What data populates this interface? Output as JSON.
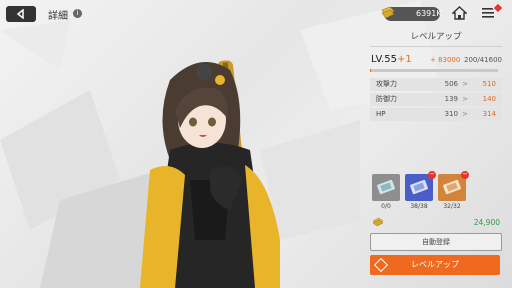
{
  "header": {
    "title": "詳細",
    "info_glyph": "i",
    "currency_value": "6391K"
  },
  "panel": {
    "title": "レベルアップ",
    "level_label": "LV.55",
    "level_increment": "+1",
    "xp_gain": "+ 83000",
    "xp_current": "200/41600",
    "xp_progress": 0.005,
    "stats": [
      {
        "name": "攻撃力",
        "current": "506",
        "arrow": ">",
        "next": "510"
      },
      {
        "name": "防御力",
        "current": "139",
        "arrow": ">",
        "next": "140"
      },
      {
        "name": "HP",
        "current": "310",
        "arrow": ">",
        "next": "314"
      }
    ],
    "items": [
      {
        "count": "0/0",
        "color": "#8e8e8e"
      },
      {
        "count": "38/38",
        "color": "#4b5ec8"
      },
      {
        "count": "32/32",
        "color": "#d2843a"
      }
    ],
    "gold_cost": "24,900",
    "auto_button": "自動登録",
    "levelup_button": "レベルアップ"
  },
  "colors": {
    "accent": "#e36b1e",
    "gold_green": "#2f9a46"
  }
}
